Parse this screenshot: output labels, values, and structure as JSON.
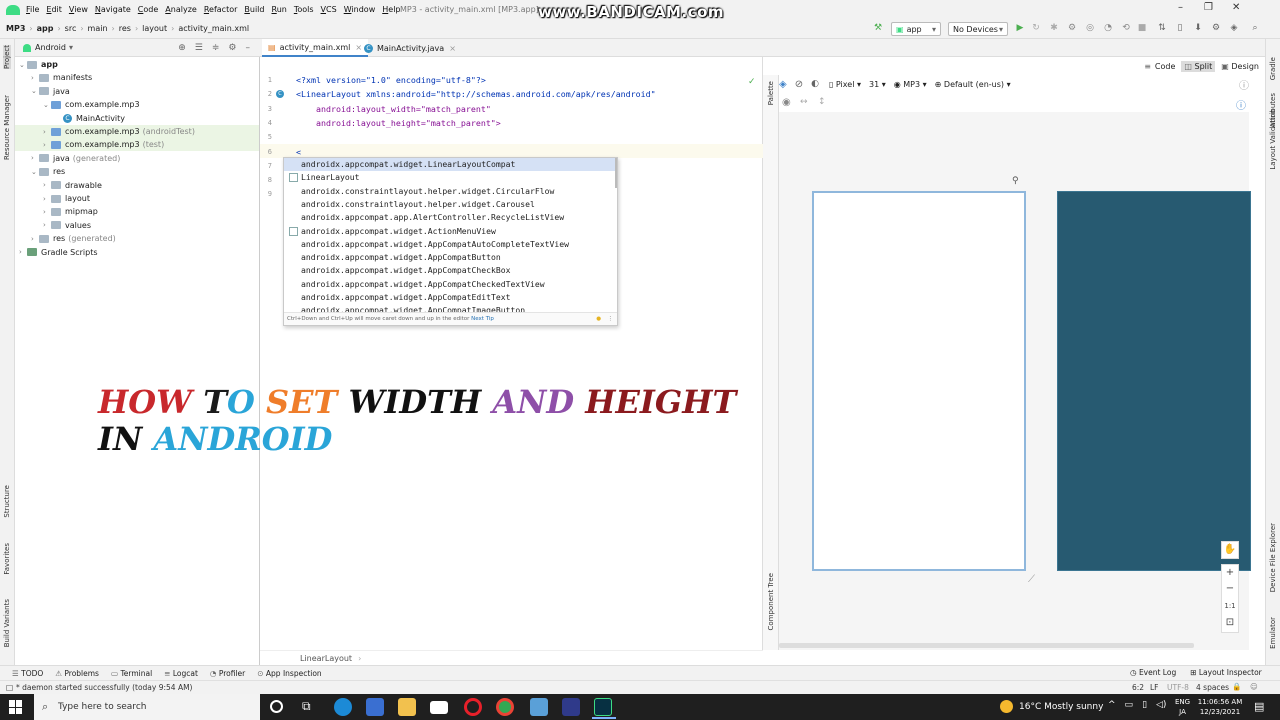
{
  "window": {
    "title": "MP3 - activity_main.xml [MP3.app]",
    "watermark": "www.BANDICAM.com"
  },
  "menu": [
    "File",
    "Edit",
    "View",
    "Navigate",
    "Code",
    "Analyze",
    "Refactor",
    "Build",
    "Run",
    "Tools",
    "VCS",
    "Window",
    "Help"
  ],
  "breadcrumbs": [
    "MP3",
    "app",
    "src",
    "main",
    "res",
    "layout",
    "activity_main.xml"
  ],
  "toolbar": {
    "run_config": "app",
    "device": "No Devices"
  },
  "left_strip": {
    "project": "Project",
    "resource_manager": "Resource Manager",
    "structure": "Structure",
    "favorites": "Favorites",
    "build_variants": "Build Variants"
  },
  "right_strip": {
    "gradle": "Gradle",
    "attributes": "Attributes",
    "layout_validation": "Layout Validation",
    "device_file_explorer": "Device File Explorer",
    "emulator": "Emulator"
  },
  "project_panel": {
    "view": "Android"
  },
  "tree": [
    {
      "label": "app",
      "extra": "",
      "depth": 0,
      "icon": "folder"
    },
    {
      "label": "manifests",
      "extra": "",
      "depth": 1,
      "icon": "folder"
    },
    {
      "label": "java",
      "extra": "",
      "depth": 1,
      "icon": "folder"
    },
    {
      "label": "com.example.mp3",
      "extra": "",
      "depth": 2,
      "icon": "folder"
    },
    {
      "label": "MainActivity",
      "extra": "",
      "depth": 3,
      "icon": "class"
    },
    {
      "label": "com.example.mp3",
      "extra": "(androidTest)",
      "depth": 2,
      "icon": "folder"
    },
    {
      "label": "com.example.mp3",
      "extra": "(test)",
      "depth": 2,
      "icon": "folder"
    },
    {
      "label": "java",
      "extra": "(generated)",
      "depth": 1,
      "icon": "folder"
    },
    {
      "label": "res",
      "extra": "",
      "depth": 1,
      "icon": "folder"
    },
    {
      "label": "drawable",
      "extra": "",
      "depth": 2,
      "icon": "folder"
    },
    {
      "label": "layout",
      "extra": "",
      "depth": 2,
      "icon": "folder"
    },
    {
      "label": "mipmap",
      "extra": "",
      "depth": 2,
      "icon": "folder"
    },
    {
      "label": "values",
      "extra": "",
      "depth": 2,
      "icon": "folder"
    },
    {
      "label": "res",
      "extra": "(generated)",
      "depth": 1,
      "icon": "folder"
    },
    {
      "label": "Gradle Scripts",
      "extra": "",
      "depth": 0,
      "icon": "gradle"
    }
  ],
  "tabs": [
    "activity_main.xml",
    "MainActivity.java"
  ],
  "code": {
    "lines": [
      "<?xml version=\"1.0\" encoding=\"utf-8\"?>",
      "<LinearLayout xmlns:android=\"http://schemas.android.com/apk/res/android\"",
      "    android:layout_width=\"match_parent\"",
      "    android:layout_height=\"match_parent\">",
      "",
      "<"
    ],
    "line_numbers": [
      "1",
      "2",
      "3",
      "4",
      "5",
      "6",
      "7",
      "8",
      "9"
    ]
  },
  "completion": {
    "items": [
      "androidx.appcompat.widget.LinearLayoutCompat",
      "LinearLayout",
      "androidx.constraintlayout.helper.widget.CircularFlow",
      "androidx.constraintlayout.helper.widget.Carousel",
      "androidx.appcompat.app.AlertController.RecycleListView",
      "androidx.appcompat.widget.ActionMenuView",
      "androidx.appcompat.widget.AppCompatAutoCompleteTextView",
      "androidx.appcompat.widget.AppCompatButton",
      "androidx.appcompat.widget.AppCompatCheckBox",
      "androidx.appcompat.widget.AppCompatCheckedTextView",
      "androidx.appcompat.widget.AppCompatEditText",
      "androidx.appcompat.widget.AppCompatImageButton"
    ],
    "footer": "Ctrl+Down and Ctrl+Up will move caret down and up in the editor",
    "footer_link": "Next Tip"
  },
  "overlay": {
    "line1": [
      "HOW ",
      "T",
      "O ",
      "SET ",
      "WIDTH ",
      "AND ",
      "HEIGHT"
    ],
    "line2": [
      "IN ",
      "ANDROID"
    ],
    "colors1": [
      "#c8282c",
      "#1a1a1a",
      "#2aa5d8",
      "#ef7d2a",
      "#111111",
      "#8e4fa8",
      "#8b1a1e"
    ],
    "colors2": [
      "#111111",
      "#2aa5d8"
    ]
  },
  "editor_breadcrumb": "LinearLayout",
  "design": {
    "modes": [
      "Code",
      "Split",
      "Design"
    ],
    "device": "Pixel",
    "api": "31",
    "theme": "MP3",
    "locale": "Default (en-us)",
    "palette": "Palette",
    "component_tree": "Component Tree",
    "zoom_ratio": "1:1"
  },
  "bottom_tabs": [
    "TODO",
    "Problems",
    "Terminal",
    "Logcat",
    "Profiler",
    "App Inspection"
  ],
  "bottom_right": [
    "Event Log",
    "Layout Inspector"
  ],
  "status": {
    "message": "* daemon started successfully (today 9:54 AM)",
    "position": "6:2",
    "line_sep": "LF",
    "encoding": "UTF-8",
    "indent": "4 spaces"
  },
  "taskbar": {
    "search": "Type here to search",
    "weather": "16°C  Mostly sunny",
    "lang1": "ENG",
    "lang2": "JA",
    "time": "11:06:56 AM",
    "date": "12/23/2021"
  }
}
